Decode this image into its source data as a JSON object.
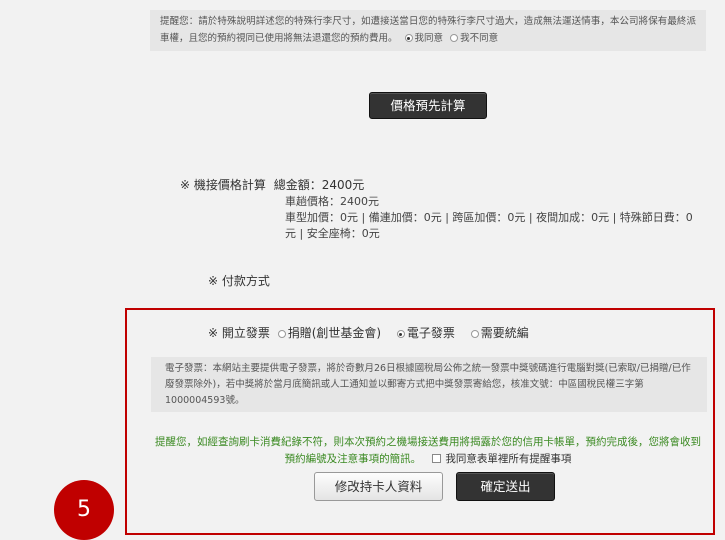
{
  "top_notice": {
    "text": "提醒您：請於特殊說明詳述您的特殊行李尺寸，如遭接送當日您的特殊行李尺寸過大，造成無法運送情事，本公司將保有最終派車權，且您的預約視同已使用將無法退還您的預約費用。",
    "agree_label": "我同意",
    "disagree_label": "我不同意"
  },
  "calc_button": "價格預先計算",
  "price": {
    "heading": "※ 機接價格計算",
    "total_label": "總金額：2400元",
    "base_label": "車趟價格：2400元",
    "detail": "車型加價：0元 | 備連加價：0元 | 跨區加價：0元 | 夜間加成：0元 | 特殊節日費：0元 | 安全座椅：0元"
  },
  "payment_label": "※ 付款方式",
  "invoice": {
    "label": "※ 開立發票",
    "options": [
      "捐贈(創世基金會)",
      "電子發票",
      "需要統編"
    ],
    "selected": "電子發票",
    "description": "電子發票：本網站主要提供電子發票，將於奇數月26日根據國稅局公佈之統一發票中獎號碼進行電腦對獎(已索取/已捐贈/已作廢發票除外)，若中獎將於當月底簡訊或人工通知並以郵寄方式把中獎發票寄給您，核准文號：中區國稅民權三字第1000004593號。"
  },
  "green_note": "提醒您，如經查詢刷卡消費紀錄不符，則本次預約之機場接送費用將揭露於您的信用卡帳單，預約完成後，您將會收到預約編號及注意事項的簡訊。",
  "agree_all_label": "我同意表單裡所有提醒事項",
  "edit_card_button": "修改持卡人資料",
  "submit_button": "確定送出",
  "step_badge": "5",
  "colors": {
    "highlight": "#c00000",
    "note_green": "#3b8a22",
    "dark_button": "#333333"
  }
}
